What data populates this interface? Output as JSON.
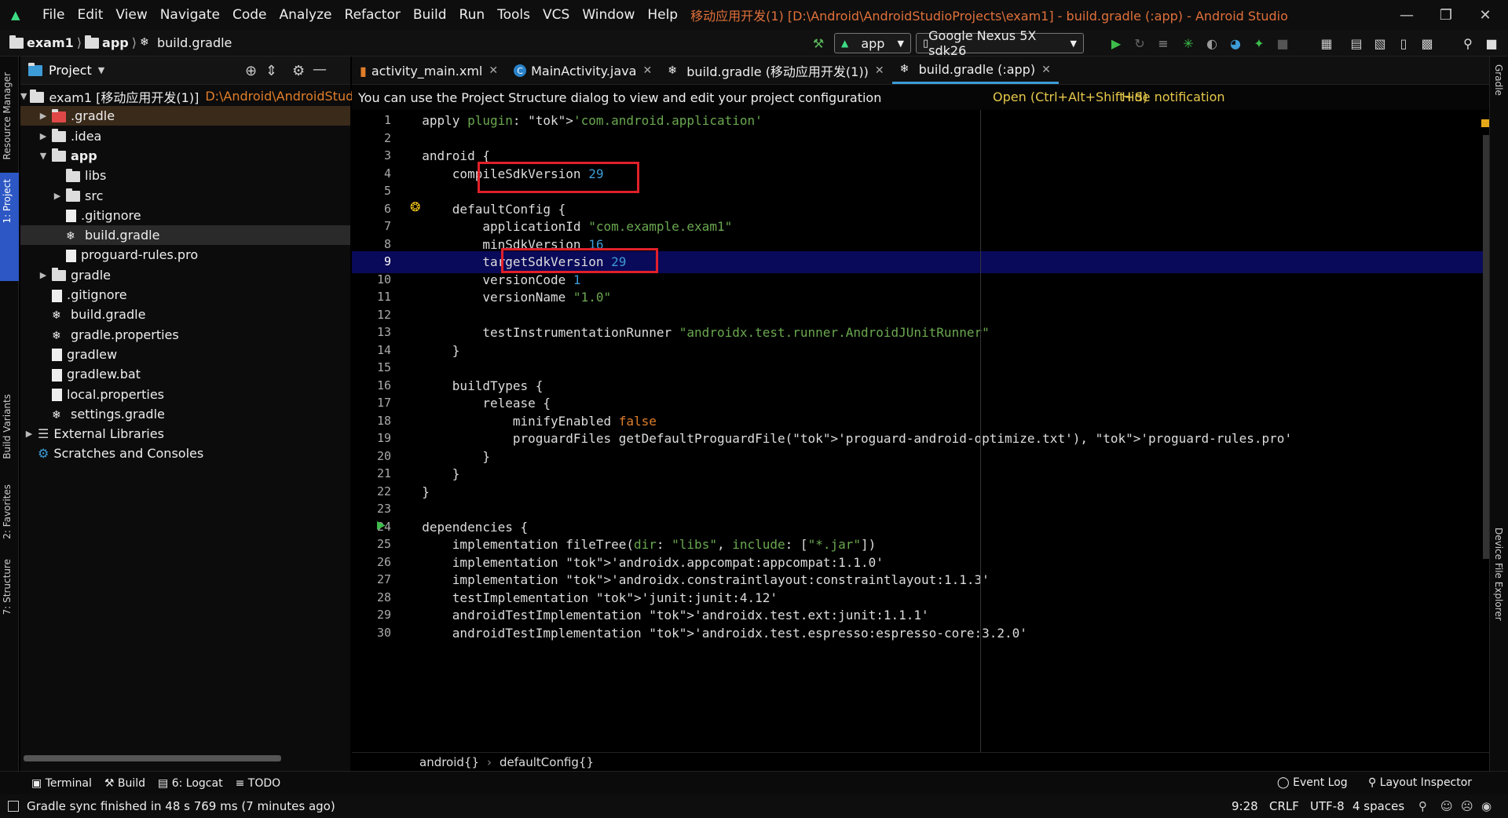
{
  "menubar": {
    "items": [
      "File",
      "Edit",
      "View",
      "Navigate",
      "Code",
      "Analyze",
      "Refactor",
      "Build",
      "Run",
      "Tools",
      "VCS",
      "Window",
      "Help"
    ],
    "title": "移动应用开发(1) [D:\\Android\\AndroidStudioProjects\\exam1] - build.gradle (:app) - Android Studio"
  },
  "navbar": {
    "crumbs": [
      "exam1",
      "app",
      "build.gradle"
    ],
    "run_config": "app",
    "device": "Google Nexus 5X sdk26"
  },
  "project_panel": {
    "title": "Project",
    "tree": [
      {
        "label": "exam1 [移动应用开发(1)]",
        "path": "D:\\Android\\AndroidStudi",
        "depth": 0,
        "arrow": "▼",
        "icon": "folder"
      },
      {
        "label": ".gradle",
        "depth": 1,
        "arrow": "▶",
        "icon": "folder-red"
      },
      {
        "label": ".idea",
        "depth": 1,
        "arrow": "▶",
        "icon": "folder"
      },
      {
        "label": "app",
        "depth": 1,
        "arrow": "▼",
        "icon": "folder"
      },
      {
        "label": "libs",
        "depth": 2,
        "arrow": "",
        "icon": "folder"
      },
      {
        "label": "src",
        "depth": 2,
        "arrow": "▶",
        "icon": "folder"
      },
      {
        "label": ".gitignore",
        "depth": 2,
        "arrow": "",
        "icon": "file"
      },
      {
        "label": "build.gradle",
        "depth": 2,
        "arrow": "",
        "icon": "gradle"
      },
      {
        "label": "proguard-rules.pro",
        "depth": 2,
        "arrow": "",
        "icon": "file"
      },
      {
        "label": "gradle",
        "depth": 1,
        "arrow": "▶",
        "icon": "folder"
      },
      {
        "label": ".gitignore",
        "depth": 1,
        "arrow": "",
        "icon": "file"
      },
      {
        "label": "build.gradle",
        "depth": 1,
        "arrow": "",
        "icon": "gradle"
      },
      {
        "label": "gradle.properties",
        "depth": 1,
        "arrow": "",
        "icon": "gradle"
      },
      {
        "label": "gradlew",
        "depth": 1,
        "arrow": "",
        "icon": "file"
      },
      {
        "label": "gradlew.bat",
        "depth": 1,
        "arrow": "",
        "icon": "file"
      },
      {
        "label": "local.properties",
        "depth": 1,
        "arrow": "",
        "icon": "file"
      },
      {
        "label": "settings.gradle",
        "depth": 1,
        "arrow": "",
        "icon": "gradle"
      },
      {
        "label": "External Libraries",
        "depth": 0,
        "arrow": "▶",
        "icon": "libs"
      },
      {
        "label": "Scratches and Consoles",
        "depth": 0,
        "arrow": "",
        "icon": "scratch"
      }
    ]
  },
  "left_tools": [
    "Resource Manager",
    "1: Project",
    "Build Variants",
    "2: Favorites",
    "7: Structure"
  ],
  "right_tools": [
    "Gradle",
    "Device File Explorer"
  ],
  "tabs": [
    {
      "label": "activity_main.xml",
      "active": false
    },
    {
      "label": "MainActivity.java",
      "active": false
    },
    {
      "label": "build.gradle (移动应用开发(1))",
      "active": false
    },
    {
      "label": "build.gradle (:app)",
      "active": true
    }
  ],
  "notification": {
    "text": "You can use the Project Structure dialog to view and edit your project configuration",
    "open": "Open (Ctrl+Alt+Shift+S)",
    "hide": "Hide notification"
  },
  "code": [
    "apply plugin: 'com.android.application'",
    "",
    "android {",
    "    compileSdkVersion 29",
    "",
    "    defaultConfig {",
    "        applicationId \"com.example.exam1\"",
    "        minSdkVersion 16",
    "        targetSdkVersion 29",
    "        versionCode 1",
    "        versionName \"1.0\"",
    "",
    "        testInstrumentationRunner \"androidx.test.runner.AndroidJUnitRunner\"",
    "    }",
    "",
    "    buildTypes {",
    "        release {",
    "            minifyEnabled false",
    "            proguardFiles getDefaultProguardFile('proguard-android-optimize.txt'), 'proguard-rules.pro'",
    "        }",
    "    }",
    "}",
    "",
    "dependencies {",
    "    implementation fileTree(dir: \"libs\", include: [\"*.jar\"])",
    "    implementation 'androidx.appcompat:appcompat:1.1.0'",
    "    implementation 'androidx.constraintlayout:constraintlayout:1.1.3'",
    "    testImplementation 'junit:junit:4.12'",
    "    androidTestImplementation 'androidx.test.ext:junit:1.1.1'",
    "    androidTestImplementation 'androidx.test.espresso:espresso-core:3.2.0'"
  ],
  "highlight_line": 9,
  "breadcrumb": [
    "android{}",
    "defaultConfig{}"
  ],
  "bottom_tools": [
    "Terminal",
    "Build",
    "6: Logcat",
    "TODO"
  ],
  "bottom_right_tools": [
    "Event Log",
    "Layout Inspector"
  ],
  "status": {
    "message": "Gradle sync finished in 48 s 769 ms (7 minutes ago)",
    "position": "9:28",
    "line_sep": "CRLF",
    "encoding": "UTF-8",
    "indent": "4 spaces"
  },
  "colors": {
    "accent": "#3d9bd6",
    "string": "#6aa84f",
    "keyword": "#e07e2a",
    "highlight": "#0a0a5a",
    "redbox": "#e0202a",
    "title": "#e0703a"
  }
}
